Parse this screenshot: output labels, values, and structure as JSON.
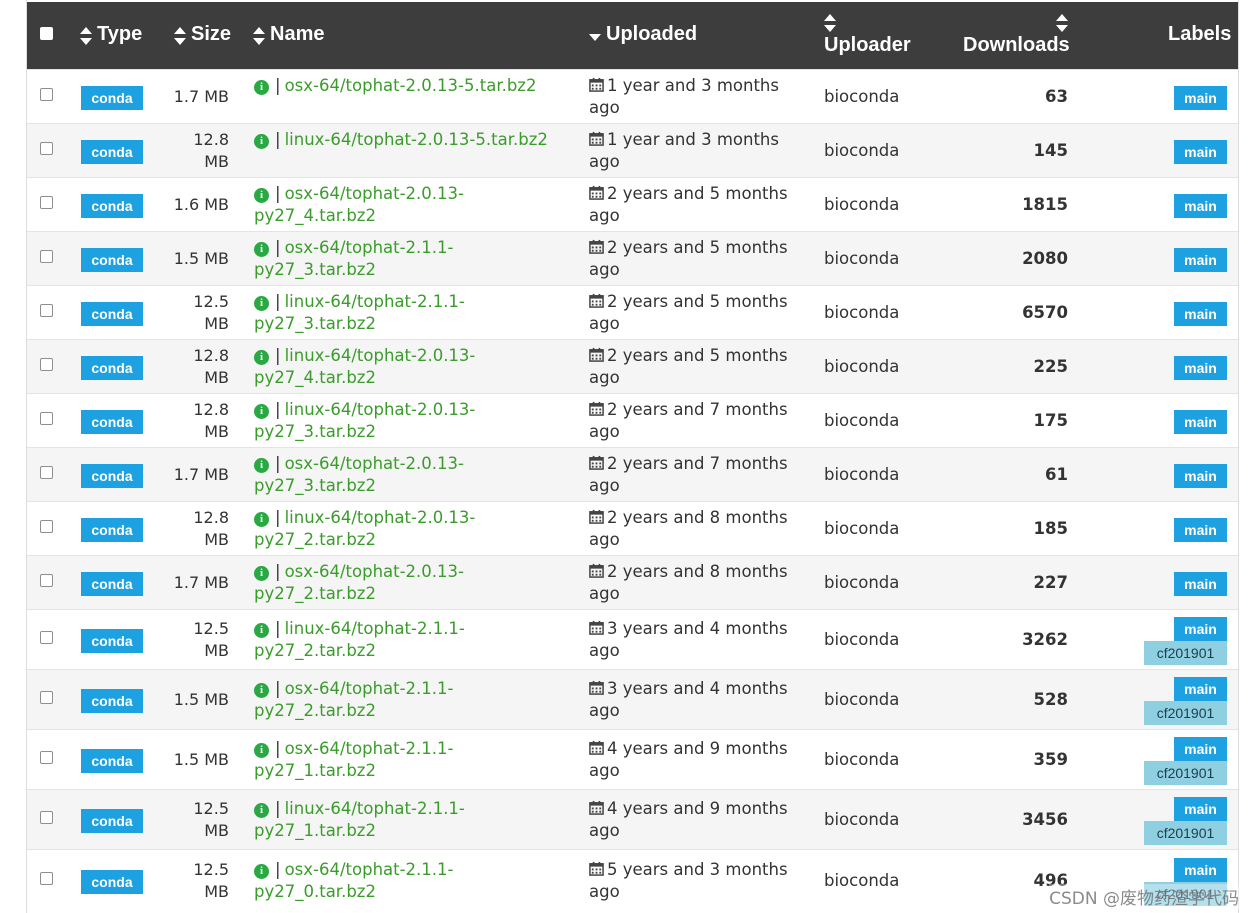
{
  "header": {
    "type_label": "Type",
    "size_label": "Size",
    "name_label": "Name",
    "uploaded_label": "Uploaded",
    "uploader_label": "Uploader",
    "downloads_label": "Downloads",
    "labels_label": "Labels"
  },
  "rows": [
    {
      "type": "conda",
      "size1": "1.7 MB",
      "size2": "",
      "name1": "osx-64/tophat-2.0.13-5.tar.bz2",
      "name2": "",
      "up1": "1 year and 3 months",
      "up2": "ago",
      "uploader": "bioconda",
      "downloads": "63",
      "label1": "main",
      "label2": ""
    },
    {
      "type": "conda",
      "size1": "12.8",
      "size2": "MB",
      "name1": "linux-64/tophat-2.0.13-5.tar.bz2",
      "name2": "",
      "up1": "1 year and 3 months",
      "up2": "ago",
      "uploader": "bioconda",
      "downloads": "145",
      "label1": "main",
      "label2": ""
    },
    {
      "type": "conda",
      "size1": "1.6 MB",
      "size2": "",
      "name1": "osx-64/tophat-2.0.13-",
      "name2": "py27_4.tar.bz2",
      "up1": "2 years and 5 months",
      "up2": "ago",
      "uploader": "bioconda",
      "downloads": "1815",
      "label1": "main",
      "label2": ""
    },
    {
      "type": "conda",
      "size1": "1.5 MB",
      "size2": "",
      "name1": "osx-64/tophat-2.1.1-",
      "name2": "py27_3.tar.bz2",
      "up1": "2 years and 5 months",
      "up2": "ago",
      "uploader": "bioconda",
      "downloads": "2080",
      "label1": "main",
      "label2": ""
    },
    {
      "type": "conda",
      "size1": "12.5",
      "size2": "MB",
      "name1": "linux-64/tophat-2.1.1-",
      "name2": "py27_3.tar.bz2",
      "up1": "2 years and 5 months",
      "up2": "ago",
      "uploader": "bioconda",
      "downloads": "6570",
      "label1": "main",
      "label2": ""
    },
    {
      "type": "conda",
      "size1": "12.8",
      "size2": "MB",
      "name1": "linux-64/tophat-2.0.13-",
      "name2": "py27_4.tar.bz2",
      "up1": "2 years and 5 months",
      "up2": "ago",
      "uploader": "bioconda",
      "downloads": "225",
      "label1": "main",
      "label2": ""
    },
    {
      "type": "conda",
      "size1": "12.8",
      "size2": "MB",
      "name1": "linux-64/tophat-2.0.13-",
      "name2": "py27_3.tar.bz2",
      "up1": "2 years and 7 months",
      "up2": "ago",
      "uploader": "bioconda",
      "downloads": "175",
      "label1": "main",
      "label2": ""
    },
    {
      "type": "conda",
      "size1": "1.7 MB",
      "size2": "",
      "name1": "osx-64/tophat-2.0.13-",
      "name2": "py27_3.tar.bz2",
      "up1": "2 years and 7 months",
      "up2": "ago",
      "uploader": "bioconda",
      "downloads": "61",
      "label1": "main",
      "label2": ""
    },
    {
      "type": "conda",
      "size1": "12.8",
      "size2": "MB",
      "name1": "linux-64/tophat-2.0.13-",
      "name2": "py27_2.tar.bz2",
      "up1": "2 years and 8 months",
      "up2": "ago",
      "uploader": "bioconda",
      "downloads": "185",
      "label1": "main",
      "label2": ""
    },
    {
      "type": "conda",
      "size1": "1.7 MB",
      "size2": "",
      "name1": "osx-64/tophat-2.0.13-",
      "name2": "py27_2.tar.bz2",
      "up1": "2 years and 8 months",
      "up2": "ago",
      "uploader": "bioconda",
      "downloads": "227",
      "label1": "main",
      "label2": ""
    },
    {
      "type": "conda",
      "size1": "12.5",
      "size2": "MB",
      "name1": "linux-64/tophat-2.1.1-",
      "name2": "py27_2.tar.bz2",
      "up1": "3 years and 4 months",
      "up2": "ago",
      "uploader": "bioconda",
      "downloads": "3262",
      "label1": "main",
      "label2": "cf201901"
    },
    {
      "type": "conda",
      "size1": "1.5 MB",
      "size2": "",
      "name1": "osx-64/tophat-2.1.1-",
      "name2": "py27_2.tar.bz2",
      "up1": "3 years and 4 months",
      "up2": "ago",
      "uploader": "bioconda",
      "downloads": "528",
      "label1": "main",
      "label2": "cf201901"
    },
    {
      "type": "conda",
      "size1": "1.5 MB",
      "size2": "",
      "name1": "osx-64/tophat-2.1.1-",
      "name2": "py27_1.tar.bz2",
      "up1": "4 years and 9 months",
      "up2": "ago",
      "uploader": "bioconda",
      "downloads": "359",
      "label1": "main",
      "label2": "cf201901"
    },
    {
      "type": "conda",
      "size1": "12.5",
      "size2": "MB",
      "name1": "linux-64/tophat-2.1.1-",
      "name2": "py27_1.tar.bz2",
      "up1": "4 years and 9 months",
      "up2": "ago",
      "uploader": "bioconda",
      "downloads": "3456",
      "label1": "main",
      "label2": "cf201901"
    },
    {
      "type": "conda",
      "size1": "12.5",
      "size2": "MB",
      "name1": "osx-64/tophat-2.1.1-",
      "name2": "py27_0.tar.bz2",
      "up1": "5 years and 3 months",
      "up2": "ago",
      "uploader": "bioconda",
      "downloads": "496",
      "label1": "main",
      "label2": "cf201901"
    }
  ],
  "watermark": "CSDN @废物药渣学代码",
  "colors": {
    "header_bg": "#3d3d3d",
    "badge_blue": "#1ea1e1",
    "label_light": "#8ecfe2",
    "link_green": "#3a9c2a",
    "info_green": "#2aa844"
  },
  "icons": {
    "sort_both": "sort-both-icon",
    "sort_down": "sort-down-icon",
    "info": "info-circle-icon",
    "calendar": "calendar-icon"
  }
}
